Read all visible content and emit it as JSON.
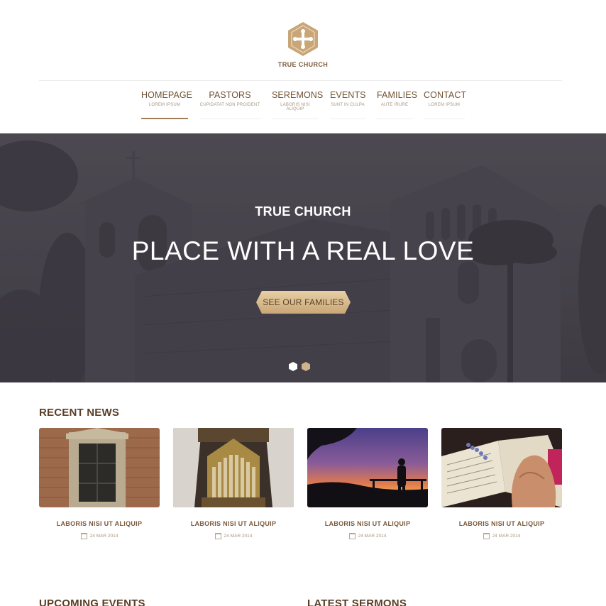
{
  "brand": {
    "name": "TRUE CHURCH",
    "logo_icon": "cross-hexagon-icon",
    "accent": "#c9a677"
  },
  "nav": {
    "items": [
      {
        "label": "HOMEPAGE",
        "sub": "LOREM IPSUM",
        "active": true
      },
      {
        "label": "PASTORS",
        "sub": "CUPIDATAT NON PROIDENT",
        "active": false
      },
      {
        "label": "SEREMONS",
        "sub": "LABORIS NISI ALIQUIP",
        "active": false
      },
      {
        "label": "EVENTS",
        "sub": "SUNT IN CULPA",
        "active": false
      },
      {
        "label": "FAMILIES",
        "sub": "AUTE IRURE",
        "active": false
      },
      {
        "label": "CONTACT",
        "sub": "LOREM IPSUM",
        "active": false
      }
    ]
  },
  "hero": {
    "kicker": "TRUE CHURCH",
    "title": "PLACE WITH A REAL LOVE",
    "button_label": "SEE OUR FAMILIES",
    "slides_count": 2
  },
  "recent_news": {
    "title": "RECENT NEWS",
    "items": [
      {
        "title": "LABORIS NISI UT ALIQUIP",
        "date": "24 MAR 2014",
        "image": "brick-doorway"
      },
      {
        "title": "LABORIS NISI UT ALIQUIP",
        "date": "24 MAR 2014",
        "image": "church-organ"
      },
      {
        "title": "LABORIS NISI UT ALIQUIP",
        "date": "24 MAR 2014",
        "image": "sunset-silhouette"
      },
      {
        "title": "LABORIS NISI UT ALIQUIP",
        "date": "24 MAR 2014",
        "image": "praying-hands-bible"
      }
    ]
  },
  "upcoming_events": {
    "title": "UPCOMING EVENTS"
  },
  "latest_sermons": {
    "title": "LATEST SERMONS"
  }
}
